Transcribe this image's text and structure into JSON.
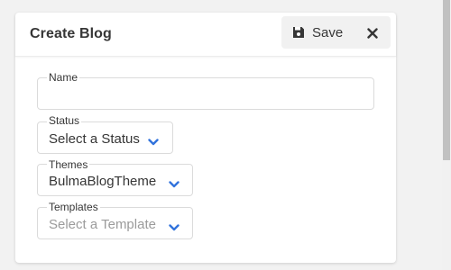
{
  "dialog": {
    "title": "Create Blog",
    "save_label": "Save",
    "close_label": "✕"
  },
  "fields": {
    "name": {
      "label": "Name",
      "value": "",
      "placeholder": ""
    },
    "status": {
      "label": "Status",
      "value": "Select a Status"
    },
    "themes": {
      "label": "Themes",
      "value": "BulmaBlogTheme"
    },
    "templates": {
      "label": "Templates",
      "value": "Select a Template"
    }
  },
  "icons": {
    "save": "floppy-disk-icon",
    "close": "close-icon",
    "chevron": "chevron-down-icon"
  },
  "colors": {
    "accent": "#3273dc",
    "text": "#363636",
    "placeholder": "#9b9b9b",
    "border": "#dbdbdb",
    "background": "#f2f2f2",
    "card": "#ffffff"
  }
}
